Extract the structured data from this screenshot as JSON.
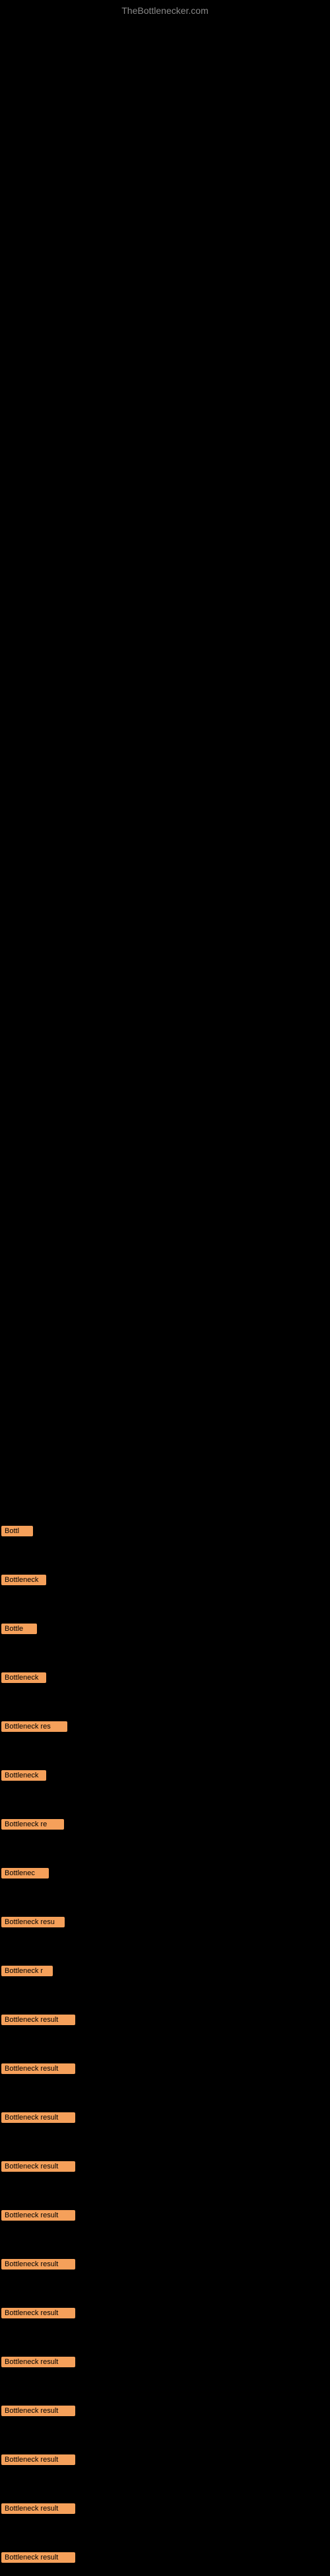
{
  "site": {
    "title": "TheBottlenecker.com"
  },
  "items": [
    {
      "id": 1,
      "label": "Bottl",
      "marginBottom": 56
    },
    {
      "id": 2,
      "label": "Bottleneck",
      "marginBottom": 56
    },
    {
      "id": 3,
      "label": "Bottle",
      "marginBottom": 56
    },
    {
      "id": 4,
      "label": "Bottleneck",
      "marginBottom": 56
    },
    {
      "id": 5,
      "label": "Bottleneck res",
      "marginBottom": 56
    },
    {
      "id": 6,
      "label": "Bottleneck",
      "marginBottom": 56
    },
    {
      "id": 7,
      "label": "Bottleneck re",
      "marginBottom": 56
    },
    {
      "id": 8,
      "label": "Bottlenec",
      "marginBottom": 56
    },
    {
      "id": 9,
      "label": "Bottleneck resu",
      "marginBottom": 56
    },
    {
      "id": 10,
      "label": "Bottleneck r",
      "marginBottom": 56
    },
    {
      "id": 11,
      "label": "Bottleneck result",
      "marginBottom": 56
    },
    {
      "id": 12,
      "label": "Bottleneck result",
      "marginBottom": 56
    },
    {
      "id": 13,
      "label": "Bottleneck result",
      "marginBottom": 56
    },
    {
      "id": 14,
      "label": "Bottleneck result",
      "marginBottom": 56
    },
    {
      "id": 15,
      "label": "Bottleneck result",
      "marginBottom": 56
    },
    {
      "id": 16,
      "label": "Bottleneck result",
      "marginBottom": 56
    },
    {
      "id": 17,
      "label": "Bottleneck result",
      "marginBottom": 56
    },
    {
      "id": 18,
      "label": "Bottleneck result",
      "marginBottom": 56
    },
    {
      "id": 19,
      "label": "Bottleneck result",
      "marginBottom": 56
    },
    {
      "id": 20,
      "label": "Bottleneck result",
      "marginBottom": 56
    },
    {
      "id": 21,
      "label": "Bottleneck result",
      "marginBottom": 56
    },
    {
      "id": 22,
      "label": "Bottleneck result",
      "marginBottom": 0
    }
  ],
  "colors": {
    "background": "#000000",
    "label_bg": "#F5A05A",
    "label_text": "#000000",
    "site_title": "#888888"
  }
}
